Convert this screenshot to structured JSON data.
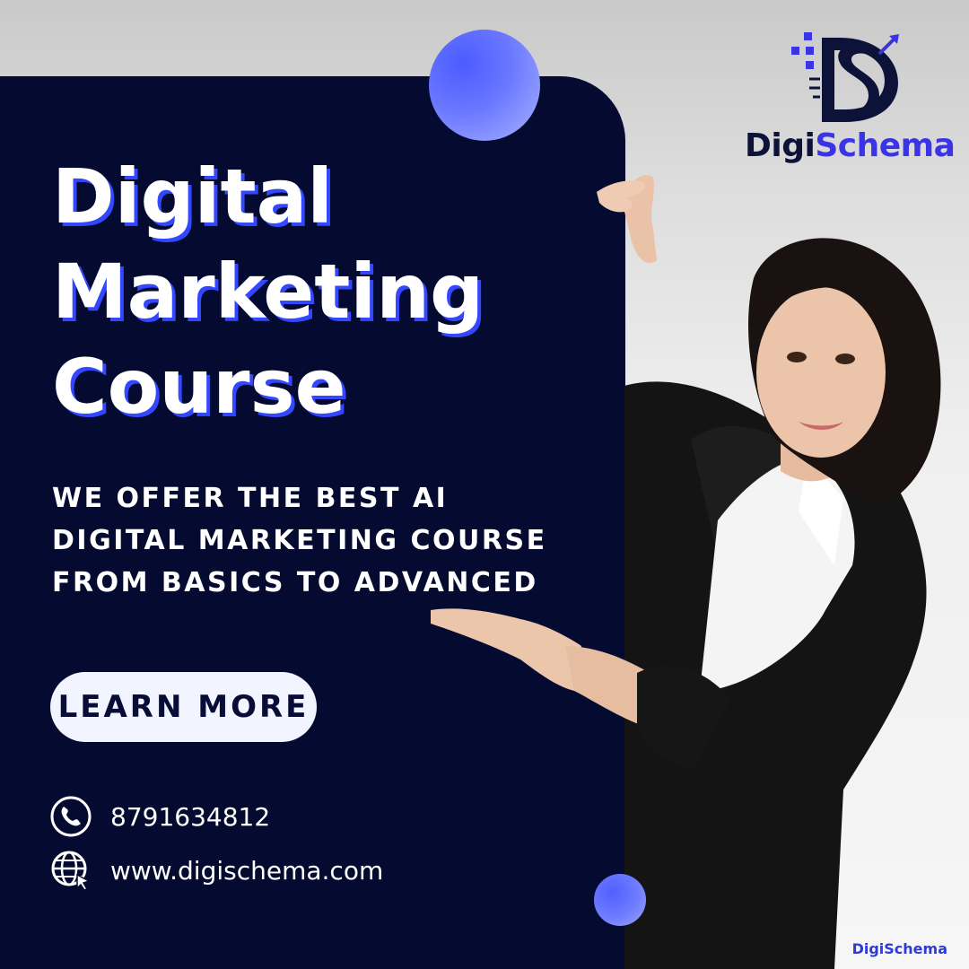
{
  "headline": {
    "line1": "Digital",
    "line2": "Marketing",
    "line3": "Course"
  },
  "subtitle": {
    "line1": "WE OFFER THE BEST AI",
    "line2": "DIGITAL MARKETING COURSE",
    "line3": "FROM BASICS TO ADVANCED"
  },
  "cta": {
    "label": "LEARN MORE"
  },
  "contact": {
    "phone": "8791634812",
    "website": "www.digischema.com"
  },
  "brand": {
    "name_part1": "Digi",
    "name_part2": "Schema",
    "footer": "DigiSchema"
  },
  "colors": {
    "panel": "#050b30",
    "accent": "#3347ff",
    "brand_blue": "#3b33e6",
    "brand_dark": "#0c1238"
  },
  "icons": [
    "phone-icon",
    "globe-icon",
    "cursor-icon"
  ]
}
